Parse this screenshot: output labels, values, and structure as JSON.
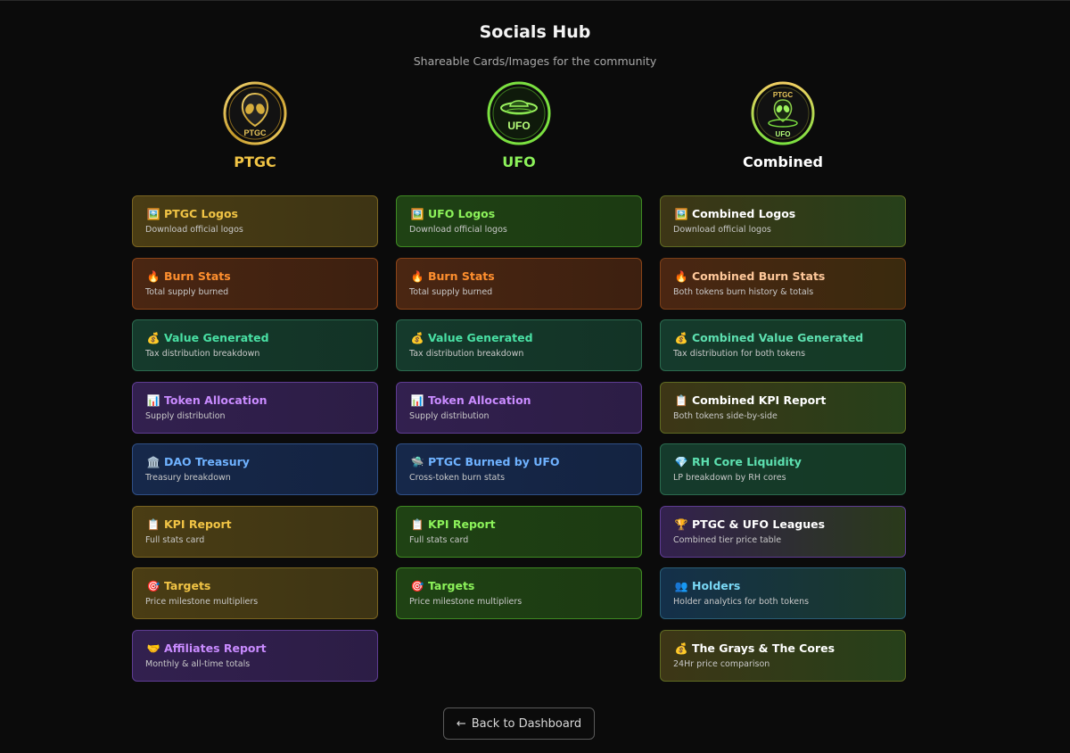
{
  "page": {
    "title": "Socials Hub",
    "subtitle": "Shareable Cards/Images for the community",
    "back_label": "Back to Dashboard"
  },
  "columns": {
    "ptgc": {
      "name": "PTGC",
      "logo_text": "PTGC",
      "color": "#f1c445",
      "cards": [
        {
          "icon": "picture-icon",
          "emoji": "🖼️",
          "title": "PTGC Logos",
          "desc": "Download official logos",
          "theme": "gold"
        },
        {
          "icon": "fire-icon",
          "emoji": "🔥",
          "title": "Burn Stats",
          "desc": "Total supply burned",
          "theme": "orange"
        },
        {
          "icon": "money-bag-icon",
          "emoji": "💰",
          "title": "Value Generated",
          "desc": "Tax distribution breakdown",
          "theme": "teal"
        },
        {
          "icon": "bar-chart-icon",
          "emoji": "📊",
          "title": "Token Allocation",
          "desc": "Supply distribution",
          "theme": "purple"
        },
        {
          "icon": "bank-icon",
          "emoji": "🏛️",
          "title": "DAO Treasury",
          "desc": "Treasury breakdown",
          "theme": "blue"
        },
        {
          "icon": "clipboard-icon",
          "emoji": "📋",
          "title": "KPI Report",
          "desc": "Full stats card",
          "theme": "gold"
        },
        {
          "icon": "target-icon",
          "emoji": "🎯",
          "title": "Targets",
          "desc": "Price milestone multipliers",
          "theme": "gold"
        },
        {
          "icon": "handshake-icon",
          "emoji": "🤝",
          "title": "Affiliates Report",
          "desc": "Monthly & all-time totals",
          "theme": "purple"
        }
      ]
    },
    "ufo": {
      "name": "UFO",
      "logo_text": "UFO",
      "color": "#8cf25a",
      "cards": [
        {
          "icon": "picture-icon",
          "emoji": "🖼️",
          "title": "UFO Logos",
          "desc": "Download official logos",
          "theme": "green"
        },
        {
          "icon": "fire-icon",
          "emoji": "🔥",
          "title": "Burn Stats",
          "desc": "Total supply burned",
          "theme": "orange"
        },
        {
          "icon": "money-bag-icon",
          "emoji": "💰",
          "title": "Value Generated",
          "desc": "Tax distribution breakdown",
          "theme": "teal"
        },
        {
          "icon": "bar-chart-icon",
          "emoji": "📊",
          "title": "Token Allocation",
          "desc": "Supply distribution",
          "theme": "purple"
        },
        {
          "icon": "ufo-icon",
          "emoji": "🛸",
          "title": "PTGC Burned by UFO",
          "desc": "Cross-token burn stats",
          "theme": "blue"
        },
        {
          "icon": "clipboard-icon",
          "emoji": "📋",
          "title": "KPI Report",
          "desc": "Full stats card",
          "theme": "green"
        },
        {
          "icon": "target-icon",
          "emoji": "🎯",
          "title": "Targets",
          "desc": "Price milestone multipliers",
          "theme": "green"
        }
      ]
    },
    "combined": {
      "name": "Combined",
      "logo_text_top": "PTGC",
      "logo_text_bottom": "UFO",
      "color": "#ffffff",
      "cards": [
        {
          "icon": "picture-icon",
          "emoji": "🖼️",
          "title": "Combined Logos",
          "desc": "Download official logos",
          "theme": "c-gold"
        },
        {
          "icon": "fire-icon",
          "emoji": "🔥",
          "title": "Combined Burn Stats",
          "desc": "Both tokens burn history & totals",
          "theme": "c-orange"
        },
        {
          "icon": "money-bag-icon",
          "emoji": "💰",
          "title": "Combined Value Generated",
          "desc": "Tax distribution for both tokens",
          "theme": "c-teal"
        },
        {
          "icon": "clipboard-icon",
          "emoji": "📋",
          "title": "Combined KPI Report",
          "desc": "Both tokens side-by-side",
          "theme": "c-gold"
        },
        {
          "icon": "diamond-icon",
          "emoji": "💎",
          "title": "RH Core Liquidity",
          "desc": "LP breakdown by RH cores",
          "theme": "c-teal"
        },
        {
          "icon": "trophy-icon",
          "emoji": "🏆",
          "title": "PTGC & UFO Leagues",
          "desc": "Combined tier price table",
          "theme": "c-purple"
        },
        {
          "icon": "people-icon",
          "emoji": "👥",
          "title": "Holders",
          "desc": "Holder analytics for both tokens",
          "theme": "c-cyan"
        },
        {
          "icon": "money-bag-icon",
          "emoji": "💰",
          "title": "The Grays & The Cores",
          "desc": "24Hr price comparison",
          "theme": "c-gold"
        }
      ]
    }
  }
}
